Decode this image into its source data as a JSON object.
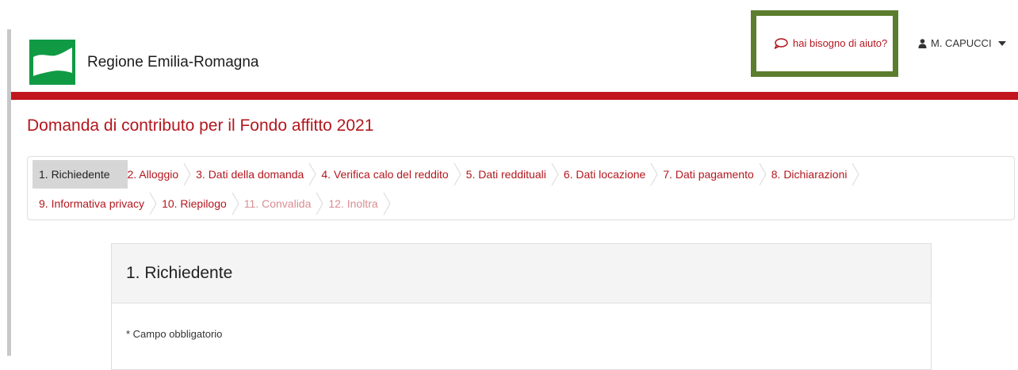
{
  "header": {
    "brand_name": "Regione Emilia-Romagna",
    "help_link": "hai bisogno di aiuto?",
    "user_name": "M. CAPUCCI",
    "colors": {
      "brand_red": "#c1161e",
      "logo_green": "#109a44",
      "highlight_box": "#5b7d2d"
    }
  },
  "page": {
    "title": "Domanda di contributo per il Fondo affitto 2021"
  },
  "stepper": {
    "row1": [
      {
        "label": "1. Richiedente",
        "state": "active"
      },
      {
        "label": "2. Alloggio",
        "state": "enabled"
      },
      {
        "label": "3. Dati della domanda",
        "state": "enabled"
      },
      {
        "label": "4. Verifica calo del reddito",
        "state": "enabled"
      },
      {
        "label": "5. Dati reddituali",
        "state": "enabled"
      },
      {
        "label": "6. Dati locazione",
        "state": "enabled"
      },
      {
        "label": "7. Dati pagamento",
        "state": "enabled"
      },
      {
        "label": "8. Dichiarazioni",
        "state": "enabled"
      }
    ],
    "row2": [
      {
        "label": "9. Informativa privacy",
        "state": "enabled"
      },
      {
        "label": "10. Riepilogo",
        "state": "enabled"
      },
      {
        "label": "11. Convalida",
        "state": "disabled"
      },
      {
        "label": "12. Inoltra",
        "state": "disabled"
      }
    ]
  },
  "section": {
    "title": "1. Richiedente",
    "required_note": "* Campo obbligatorio"
  }
}
